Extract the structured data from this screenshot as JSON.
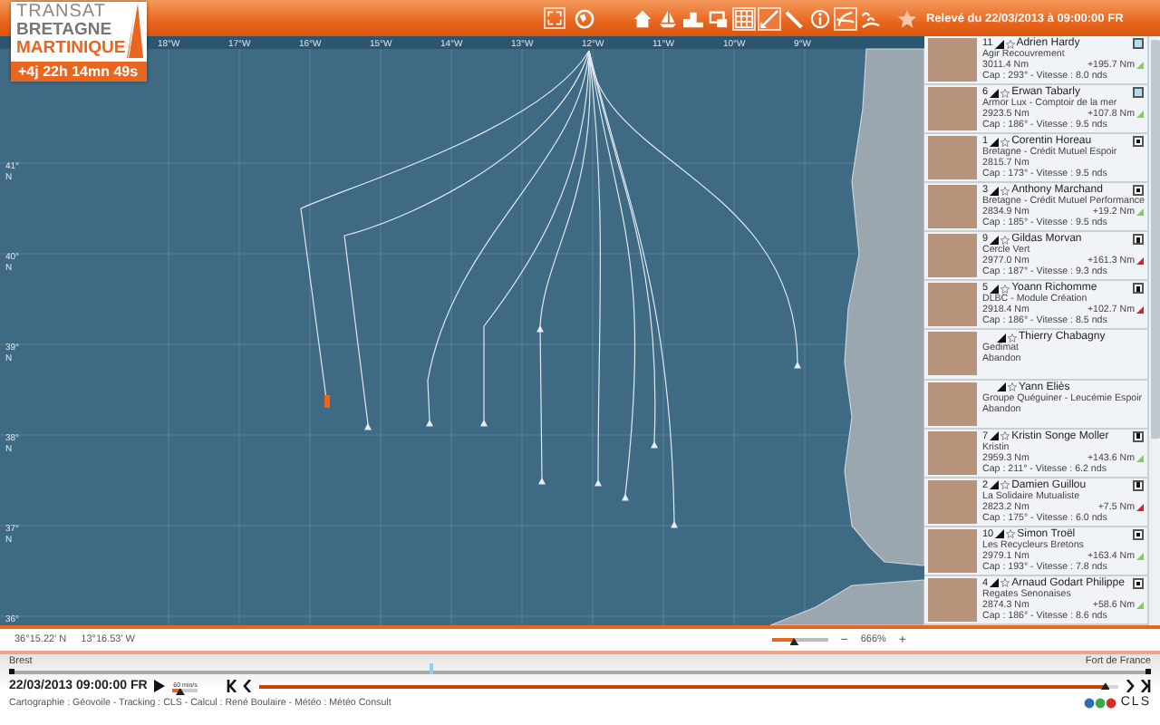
{
  "logo": {
    "line_1": "TRANSAT",
    "line_2": "BRETAGNE",
    "line_3": "MARTINIQUE",
    "elapsed": "+4j 22h 14mn 49s"
  },
  "toolbar": [
    {
      "kind": "globe",
      "selected": false
    },
    {
      "kind": "home",
      "selected": false
    },
    {
      "kind": "boat",
      "selected": false
    },
    {
      "kind": "ranking",
      "selected": false
    },
    {
      "kind": "message",
      "selected": false
    },
    {
      "kind": "grid",
      "selected": true
    },
    {
      "kind": "route",
      "selected": true
    },
    {
      "kind": "ruler",
      "selected": false
    },
    {
      "kind": "info",
      "selected": false
    },
    {
      "kind": "wind",
      "selected": true
    },
    {
      "kind": "waves",
      "selected": false
    },
    {
      "kind": "star",
      "selected": false
    }
  ],
  "report_time": "Relevé du 22/03/2013 à 09:00:00 FR",
  "map": {
    "longitudes": [
      "18°W",
      "17°W",
      "16°W",
      "15°W",
      "14°W",
      "13°W",
      "12°W",
      "11°W",
      "10°W",
      "9°W"
    ],
    "latitudes": [
      {
        "deg": "41°",
        "hemi": "N"
      },
      {
        "deg": "40°",
        "hemi": "N"
      },
      {
        "deg": "39°",
        "hemi": "N"
      },
      {
        "deg": "38°",
        "hemi": "N"
      },
      {
        "deg": "37°",
        "hemi": "N"
      },
      {
        "deg": "36°"
      }
    ]
  },
  "skippers": [
    {
      "rank": "11",
      "name": "Adrien Hardy",
      "team": "Agir Recouvrement",
      "distance": "3011.4 Nm",
      "gap": "+195.7 Nm",
      "color": "#7cd64b",
      "course": "Cap : 293° - Vitesse : 8.0 nds",
      "checked": false
    },
    {
      "rank": "6",
      "name": "Erwan Tabarly",
      "team": "Armor Lux - Comptoir de la mer",
      "distance": "2923.5 Nm",
      "gap": "+107.8 Nm",
      "color": "#7cd64b",
      "course": "Cap : 186° - Vitesse : 9.5 nds",
      "checked": false
    },
    {
      "rank": "1",
      "name": "Corentin Horeau",
      "team": "Bretagne - Crédit Mutuel Espoir",
      "distance": "2815.7 Nm",
      "course": "Cap : 173° - Vitesse : 9.5 nds",
      "checked": true
    },
    {
      "rank": "3",
      "name": "Anthony Marchand",
      "team": "Bretagne - Crédit Mutuel Performance",
      "distance": "2834.9 Nm",
      "gap": "+19.2 Nm",
      "color": "#7cd64b",
      "course": "Cap : 185° - Vitesse : 9.5 nds",
      "checked": true
    },
    {
      "rank": "9",
      "name": "Gildas Morvan",
      "team": "Cercle Vert",
      "distance": "2977.0 Nm",
      "gap": "+161.3 Nm",
      "color": "#e02020",
      "course": "Cap : 187° - Vitesse : 9.3 nds",
      "checked": true
    },
    {
      "rank": "5",
      "name": "Yoann Richomme",
      "team": "DLBC - Module Création",
      "distance": "2918.4 Nm",
      "gap": "+102.7 Nm",
      "color": "#e02020",
      "course": "Cap : 186° - Vitesse : 8.5 nds",
      "checked": true
    },
    {
      "name": "Thierry Chabagny",
      "team": "Gedimat",
      "status": "Abandon"
    },
    {
      "name": "Yann Eliès",
      "team": "Groupe Quéguiner - Leucémie Espoir",
      "status": "Abandon"
    },
    {
      "rank": "7",
      "name": "Kristin Songe Moller",
      "team": "Kristin",
      "distance": "2959.3 Nm",
      "gap": "+143.6 Nm",
      "color": "#7cd64b",
      "course": "Cap : 211° - Vitesse : 6.2 nds",
      "checked": true
    },
    {
      "rank": "2",
      "name": "Damien Guillou",
      "team": "La Solidaire Mutualiste",
      "distance": "2823.2 Nm",
      "gap": "+7.5 Nm",
      "color": "#e02020",
      "course": "Cap : 175° - Vitesse : 6.0 nds",
      "checked": true
    },
    {
      "rank": "10",
      "name": "Simon Troël",
      "team": "Les Recycleurs Bretons",
      "distance": "2979.1 Nm",
      "gap": "+163.4 Nm",
      "color": "#7cd64b",
      "course": "Cap : 193° - Vitesse : 7.8 nds",
      "checked": true
    },
    {
      "rank": "4",
      "name": "Arnaud Godart Philippe",
      "team": "Regates Senonaises",
      "distance": "2874.3 Nm",
      "gap": "+58.6 Nm",
      "color": "#7cd64b",
      "course": "Cap : 186° - Vitesse : 8.6 nds",
      "checked": true
    }
  ],
  "coordinates": {
    "latitude": "36°15.22' N",
    "longitude": "13°16.53' W"
  },
  "zoom": {
    "level": 0.4,
    "minus": "−",
    "reading": "666%",
    "plus": "+"
  },
  "timeline": {
    "start": "Brest",
    "end": "Fort de France",
    "level": 0.37,
    "datetime": "22/03/2013 09:00:00 FR",
    "speed": {
      "label": "60 min/s",
      "level": 0.3
    },
    "playback": {
      "level": 0.985
    }
  },
  "credits": "Cartographie : Géovoile - Tracking : CLS - Calcul : René Boulaire - Météo : Météo Consult",
  "partner_logo": "CLS"
}
